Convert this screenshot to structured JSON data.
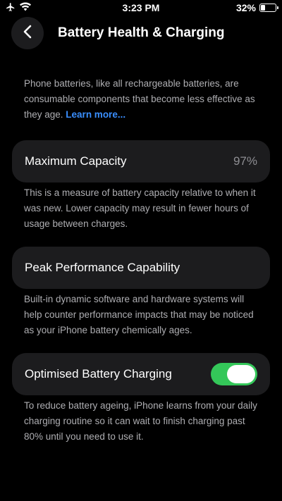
{
  "status_bar": {
    "time": "3:23 PM",
    "battery_percent": "32%",
    "battery_level": 0.32,
    "icons": [
      "airplane-icon",
      "wifi-icon",
      "battery-icon"
    ]
  },
  "header": {
    "back_icon": "chevron-left-icon",
    "title": "Battery Health & Charging"
  },
  "intro": {
    "text": "Phone batteries, like all rechargeable batteries, are consumable components that become less effective as they age. ",
    "link": "Learn more..."
  },
  "max_capacity": {
    "label": "Maximum Capacity",
    "value": "97%",
    "description": "This is a measure of battery capacity relative to when it was new. Lower capacity may result in fewer hours of usage between charges."
  },
  "peak_performance": {
    "label": "Peak Performance Capability",
    "description": "Built-in dynamic software and hardware systems will help counter performance impacts that may be noticed as your iPhone battery chemically ages."
  },
  "optimised_charging": {
    "label": "Optimised Battery Charging",
    "enabled": true,
    "description": "To reduce battery ageing, iPhone learns from your daily charging routine so it can wait to finish charging past 80% until you need to use it."
  },
  "colors": {
    "background": "#000000",
    "card": "#1c1c1e",
    "secondary_text": "#aeaeb2",
    "link": "#3a8fff",
    "toggle_on": "#34c759"
  }
}
